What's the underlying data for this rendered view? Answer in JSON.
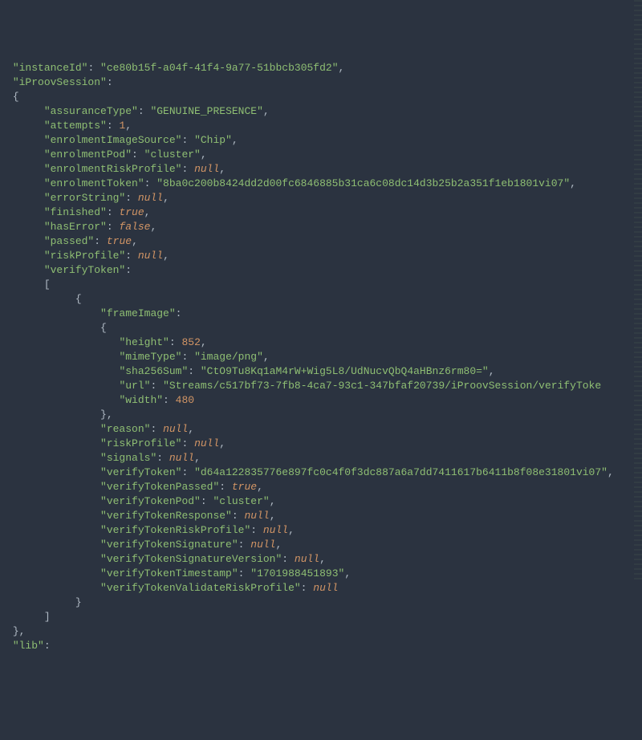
{
  "root": {
    "instanceId_key": "\"instanceId\"",
    "instanceId_val": "\"ce80b15f-a04f-41f4-9a77-51bbcb305fd2\"",
    "iProovSession_key": "\"iProovSession\"",
    "iProov": {
      "assuranceType": {
        "k": "\"assuranceType\"",
        "v": "\"GENUINE_PRESENCE\""
      },
      "attempts": {
        "k": "\"attempts\"",
        "v": "1"
      },
      "enrolmentImageSource": {
        "k": "\"enrolmentImageSource\"",
        "v": "\"Chip\""
      },
      "enrolmentPod": {
        "k": "\"enrolmentPod\"",
        "v": "\"cluster\""
      },
      "enrolmentRiskProfile": {
        "k": "\"enrolmentRiskProfile\"",
        "v": "null"
      },
      "enrolmentToken": {
        "k": "\"enrolmentToken\"",
        "v": "\"8ba0c200b8424dd2d00fc6846885b31ca6c08dc14d3b25b2a351f1eb1801vi07\""
      },
      "errorString": {
        "k": "\"errorString\"",
        "v": "null"
      },
      "finished": {
        "k": "\"finished\"",
        "v": "true"
      },
      "hasError": {
        "k": "\"hasError\"",
        "v": "false"
      },
      "passed": {
        "k": "\"passed\"",
        "v": "true"
      },
      "riskProfile": {
        "k": "\"riskProfile\"",
        "v": "null"
      },
      "verifyToken_key": "\"verifyToken\""
    },
    "vt": {
      "frameImage_key": "\"frameImage\"",
      "frameImage": {
        "height": {
          "k": "\"height\"",
          "v": "852"
        },
        "mimeType": {
          "k": "\"mimeType\"",
          "v": "\"image/png\""
        },
        "sha256Sum": {
          "k": "\"sha256Sum\"",
          "v": "\"CtO9Tu8Kq1aM4rW+Wig5L8/UdNucvQbQ4aHBnz6rm80=\""
        },
        "url": {
          "k": "\"url\"",
          "v": "\"Streams/c517bf73-7fb8-4ca7-93c1-347bfaf20739/iProovSession/verifyToke"
        },
        "width": {
          "k": "\"width\"",
          "v": "480"
        }
      },
      "reason": {
        "k": "\"reason\"",
        "v": "null"
      },
      "riskProfile": {
        "k": "\"riskProfile\"",
        "v": "null"
      },
      "signals": {
        "k": "\"signals\"",
        "v": "null"
      },
      "verifyToken": {
        "k": "\"verifyToken\"",
        "v": "\"d64a122835776e897fc0c4f0f3dc887a6a7dd7411617b6411b8f08e31801vi07\""
      },
      "verifyTokenPassed": {
        "k": "\"verifyTokenPassed\"",
        "v": "true"
      },
      "verifyTokenPod": {
        "k": "\"verifyTokenPod\"",
        "v": "\"cluster\""
      },
      "verifyTokenResponse": {
        "k": "\"verifyTokenResponse\"",
        "v": "null"
      },
      "verifyTokenRiskProfile": {
        "k": "\"verifyTokenRiskProfile\"",
        "v": "null"
      },
      "verifyTokenSignature": {
        "k": "\"verifyTokenSignature\"",
        "v": "null"
      },
      "verifyTokenSignatureVersion": {
        "k": "\"verifyTokenSignatureVersion\"",
        "v": "null"
      },
      "verifyTokenTimestamp": {
        "k": "\"verifyTokenTimestamp\"",
        "v": "\"1701988451893\""
      },
      "verifyTokenValidateRiskProfile": {
        "k": "\"verifyTokenValidateRiskProfile\"",
        "v": "null"
      }
    },
    "lib_key": "\"lib\""
  }
}
